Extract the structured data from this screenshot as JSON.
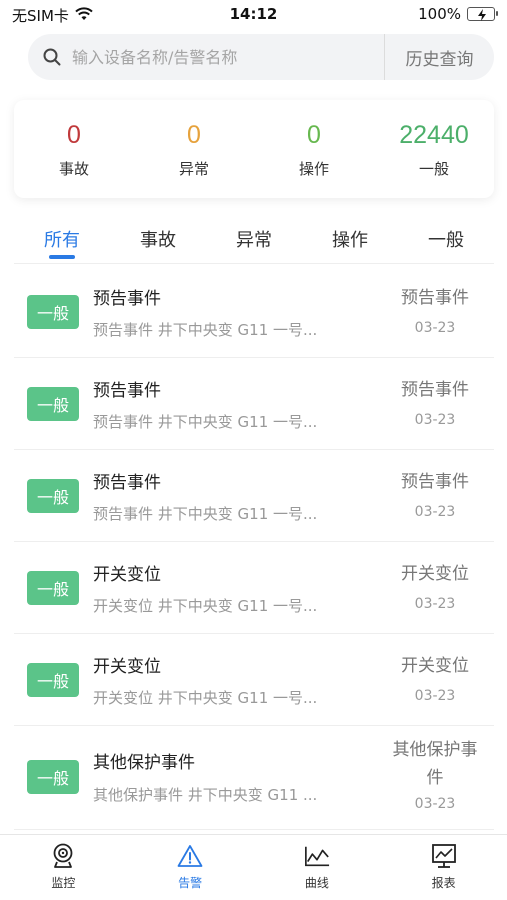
{
  "status_bar": {
    "carrier": "无SIM卡",
    "time": "14:12",
    "battery": "100%"
  },
  "search": {
    "placeholder": "输入设备名称/告警名称",
    "value": "",
    "history_label": "历史查询"
  },
  "stats": [
    {
      "value": "0",
      "label": "事故",
      "color": "#c0393b"
    },
    {
      "value": "0",
      "label": "异常",
      "color": "#e6a23c"
    },
    {
      "value": "0",
      "label": "操作",
      "color": "#67b84f"
    },
    {
      "value": "22440",
      "label": "一般",
      "color": "#4caf6a"
    }
  ],
  "tabs": [
    {
      "label": "所有",
      "active": true
    },
    {
      "label": "事故",
      "active": false
    },
    {
      "label": "异常",
      "active": false
    },
    {
      "label": "操作",
      "active": false
    },
    {
      "label": "一般",
      "active": false
    }
  ],
  "events": [
    {
      "badge": "一般",
      "title": "预告事件",
      "desc": "预告事件 井下中央变 G11 一号...",
      "type": "预告事件",
      "date": "03-23"
    },
    {
      "badge": "一般",
      "title": "预告事件",
      "desc": "预告事件 井下中央变 G11 一号...",
      "type": "预告事件",
      "date": "03-23"
    },
    {
      "badge": "一般",
      "title": "预告事件",
      "desc": "预告事件 井下中央变 G11 一号...",
      "type": "预告事件",
      "date": "03-23"
    },
    {
      "badge": "一般",
      "title": "开关变位",
      "desc": "开关变位 井下中央变 G11 一号...",
      "type": "开关变位",
      "date": "03-23"
    },
    {
      "badge": "一般",
      "title": "开关变位",
      "desc": "开关变位 井下中央变 G11 一号...",
      "type": "开关变位",
      "date": "03-23"
    },
    {
      "badge": "一般",
      "title": "其他保护事件",
      "desc": "其他保护事件 井下中央变 G11 ...",
      "type": "其他保护事件",
      "date": "03-23"
    }
  ],
  "tabbar": [
    {
      "label": "监控",
      "icon": "camera-icon",
      "active": false
    },
    {
      "label": "告警",
      "icon": "warning-icon",
      "active": true
    },
    {
      "label": "曲线",
      "icon": "line-chart-icon",
      "active": false
    },
    {
      "label": "报表",
      "icon": "report-icon",
      "active": false
    }
  ],
  "colors": {
    "accent": "#2a7ae4",
    "badge": "#5bc489"
  }
}
